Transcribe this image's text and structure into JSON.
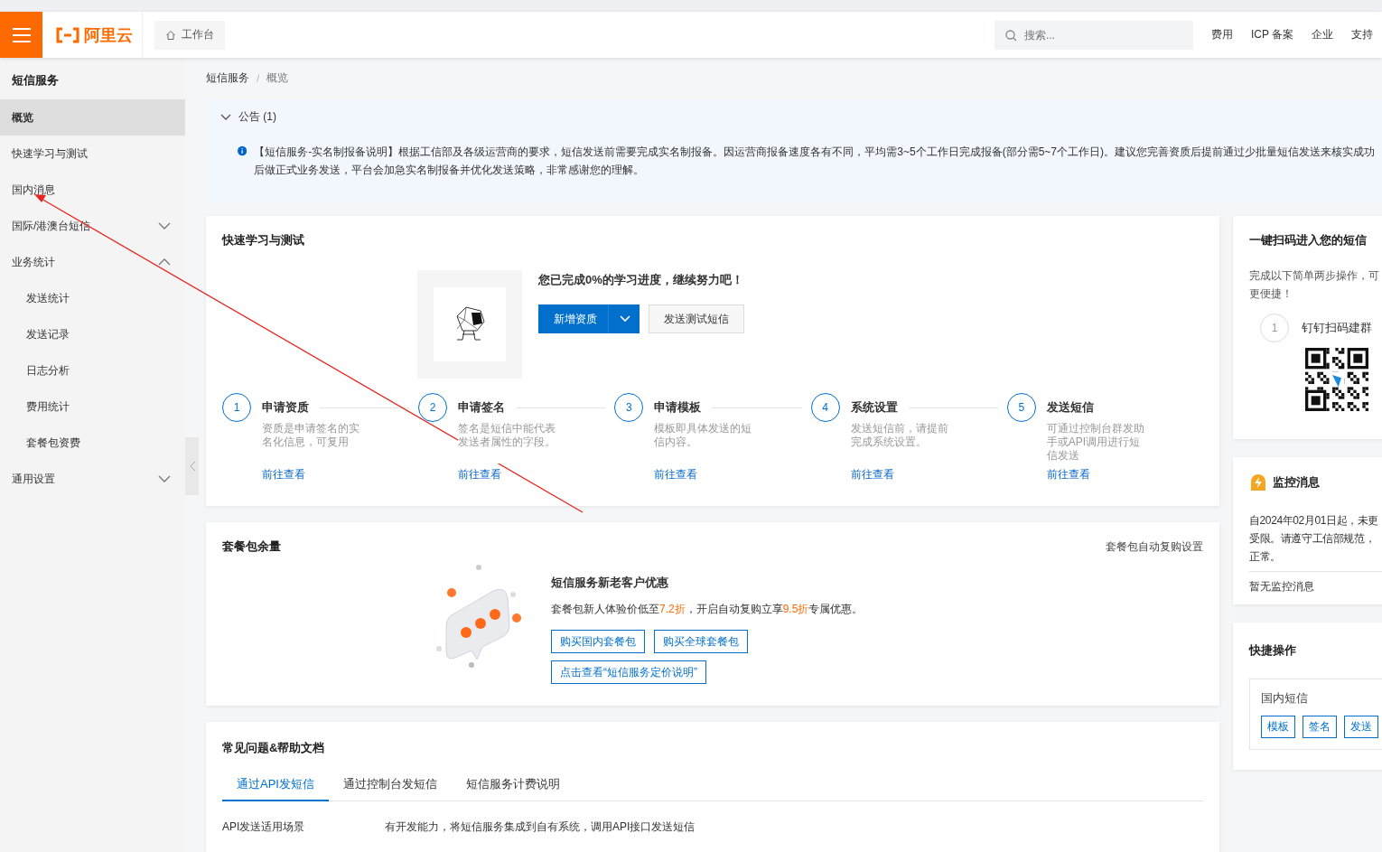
{
  "header": {
    "logo": "阿里云",
    "workbench": "工作台",
    "search": {
      "placeholder": "搜索..."
    },
    "nav": [
      "费用",
      "ICP 备案",
      "企业",
      "支持"
    ]
  },
  "sidebar": {
    "title": "短信服务",
    "items": [
      {
        "label": "概览",
        "kind": "link",
        "selected": true
      },
      {
        "label": "快速学习与测试",
        "kind": "link",
        "selected": false
      },
      {
        "label": "国内消息",
        "kind": "link",
        "selected": false
      },
      {
        "label": "国际/港澳台短信",
        "kind": "group",
        "selected": false,
        "expanded": false
      },
      {
        "label": "业务统计",
        "kind": "group",
        "selected": false,
        "expanded": true,
        "children": [
          {
            "label": "发送统计",
            "selected": false
          },
          {
            "label": "发送记录",
            "selected": false
          },
          {
            "label": "日志分析",
            "selected": false
          },
          {
            "label": "费用统计",
            "selected": false
          },
          {
            "label": "套餐包资费",
            "selected": false
          }
        ]
      },
      {
        "label": "通用设置",
        "kind": "group",
        "selected": false,
        "expanded": false
      }
    ]
  },
  "breadcrumb": {
    "items": [
      "短信服务",
      "概览"
    ],
    "separator": "/"
  },
  "notice": {
    "title": "公告 (1)",
    "expanded": true,
    "text": "【短信服务-实名制报备说明】根据工信部及各级运营商的要求，短信发送前需要完成实名制报备。因运营商报备速度各有不同，平均需3~5个工作日完成报备(部分需5~7个工作日)。建议您完善资质后提前通过少批量短信发送来核实成功",
    "text_2": "后做正式业务发送，平台会加急实名制报备并优化发送策略，非常感谢您的理解。"
  },
  "learning": {
    "title": "快速学习与测试",
    "progress": "您已完成0%的学习进度，继续努力吧！",
    "primary_button": "新增资质",
    "secondary_button": "发送测试短信",
    "steps": [
      {
        "number": "1",
        "title": "申请资质",
        "desc": "资质是申请签名的实名化信息，可复用",
        "link": "前往查看"
      },
      {
        "number": "2",
        "title": "申请签名",
        "desc": "签名是短信中能代表发送者属性的字段。",
        "link": "前往查看"
      },
      {
        "number": "3",
        "title": "申请模板",
        "desc": "模板即具体发送的短信内容。",
        "link": "前往查看"
      },
      {
        "number": "4",
        "title": "系统设置",
        "desc": "发送短信前，请提前完成系统设置。",
        "link": "前往查看"
      },
      {
        "number": "5",
        "title": "发送短信",
        "desc": "可通过控制台群发助手或API调用进行短信发送",
        "link": "前往查看"
      }
    ]
  },
  "package": {
    "title": "套餐包余量",
    "settings_link": "套餐包自动复购设置",
    "promo_title": "短信服务新老客户优惠",
    "promo_text": [
      {
        "text": "套餐包新人体验价低至",
        "highlight": false
      },
      {
        "text": "7.2折",
        "highlight": true
      },
      {
        "text": "，开启自动复购立享",
        "highlight": false
      },
      {
        "text": "9.5折",
        "highlight": true
      },
      {
        "text": "专属优惠。",
        "highlight": false
      }
    ],
    "buttons": [
      "购买国内套餐包",
      "购买全球套餐包"
    ],
    "pricing_button": "点击查看“短信服务定价说明”"
  },
  "faq": {
    "title": "常见问题&帮助文档",
    "tabs": [
      {
        "label": "通过API发短信",
        "selected": true
      },
      {
        "label": "通过控制台发短信",
        "selected": false
      },
      {
        "label": "短信服务计费说明",
        "selected": false
      }
    ],
    "rows": [
      {
        "label": "API发送适用场景",
        "text": "有开发能力，将短信服务集成到自有系统，调用API接口发送短信"
      }
    ]
  },
  "scan_card": {
    "title": "一键扫码进入您的短信",
    "text": "完成以下简单两步操作，可",
    "text_2": "更便捷！",
    "steps": [
      {
        "number": "1",
        "label": "钉钉扫码建群"
      }
    ]
  },
  "monitor": {
    "title": "监控消息",
    "lines": [
      "自2024年02月01日起，未更",
      "受限。请遵守工信部规范，",
      "正常。"
    ],
    "empty": "暂无监控消息"
  },
  "quick_ops": {
    "title": "快捷操作",
    "group": "国内短信",
    "buttons": [
      "模板",
      "签名",
      "发送"
    ]
  }
}
